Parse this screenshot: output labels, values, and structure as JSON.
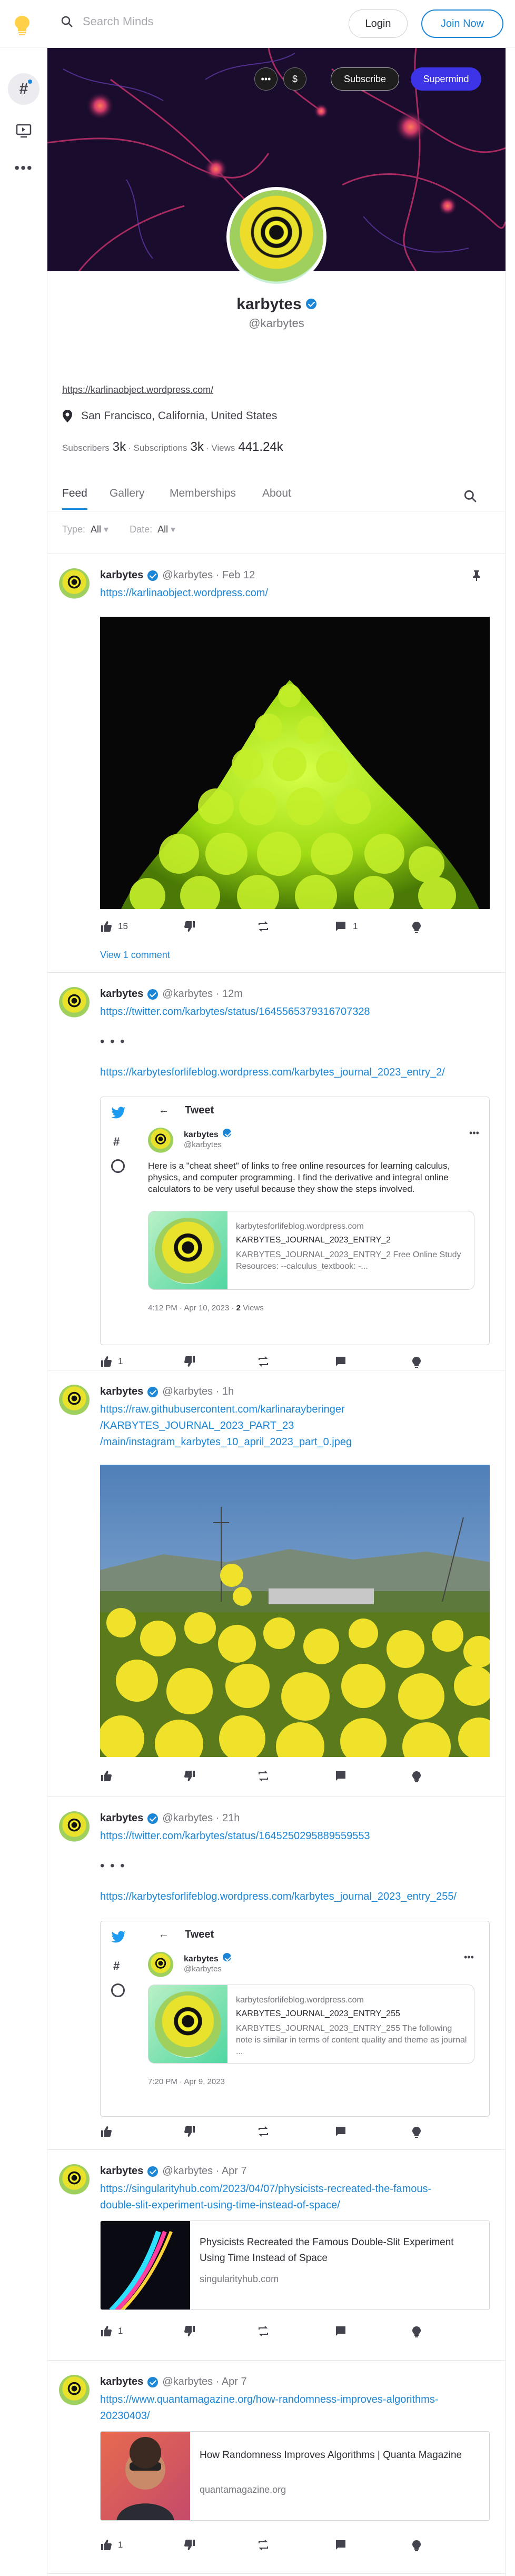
{
  "topbar": {
    "search_placeholder": "Search Minds",
    "login_label": "Login",
    "join_label": "Join Now"
  },
  "banner": {
    "subscribe_label": "Subscribe",
    "supermind_label": "Supermind"
  },
  "profile": {
    "name": "karbytes",
    "handle": "@karbytes",
    "link": "https://karlinaobject.wordpress.com/",
    "location": "San Francisco, California, United States",
    "subscribers_label": "Subscribers",
    "subscribers": "3k",
    "subscriptions_label": "· Subscriptions",
    "subscriptions": "3k",
    "views_label": "· Views",
    "views": "441.24k"
  },
  "tabs": [
    "Feed",
    "Gallery",
    "Memberships",
    "About"
  ],
  "filters": {
    "type_label": "Type:",
    "type_value": "All",
    "date_label": "Date:",
    "date_value": "All"
  },
  "posts": [
    {
      "name": "karbytes",
      "handle": "@karbytes · Feb 12",
      "link": "https://karlinaobject.wordpress.com/",
      "likes": "15",
      "comments": "1",
      "view_comments": "View 1 comment"
    },
    {
      "name": "karbytes",
      "handle": "@karbytes · 12m",
      "link1": "https://twitter.com/karbytes/status/1645565379316707328",
      "dots": "• • •",
      "link2": "https://karbytesforlifeblog.wordpress.com/karbytes_journal_2023_entry_2/",
      "tweet": {
        "header": "Tweet",
        "name": "karbytes",
        "handle": "@karbytes",
        "text": "Here is a \"cheat sheet\" of links to free online resources for learning calculus, physics, and computer programming. I find the derivative and integral online calculators to be very useful because they show the steps involved.",
        "card_domain": "karbytesforlifeblog.wordpress.com",
        "card_title": "KARBYTES_JOURNAL_2023_ENTRY_2",
        "card_desc": "KARBYTES_JOURNAL_2023_ENTRY_2 Free Online Study Resources: --calculus_textbook: -...",
        "time": "4:12 PM · Apr 10, 2023 ·",
        "views_n": "2",
        "views": "Views"
      },
      "likes": "1"
    },
    {
      "name": "karbytes",
      "handle": "@karbytes · 1h",
      "link_lines": [
        "https://raw.githubusercontent.com/karlinarayberinger",
        "/KARBYTES_JOURNAL_2023_PART_23",
        "/main/instagram_karbytes_10_april_2023_part_0.jpeg"
      ]
    },
    {
      "name": "karbytes",
      "handle": "@karbytes · 21h",
      "link1": "https://twitter.com/karbytes/status/1645250295889559553",
      "dots": "• • •",
      "link2": "https://karbytesforlifeblog.wordpress.com/karbytes_journal_2023_entry_255/",
      "tweet": {
        "header": "Tweet",
        "name": "karbytes",
        "handle": "@karbytes",
        "card_domain": "karbytesforlifeblog.wordpress.com",
        "card_title": "KARBYTES_JOURNAL_2023_ENTRY_255",
        "card_desc": "KARBYTES_JOURNAL_2023_ENTRY_255 The following note is similar in terms of content quality and theme as journal ...",
        "time": "7:20 PM · Apr 9, 2023"
      }
    },
    {
      "name": "karbytes",
      "handle": "@karbytes · Apr 7",
      "link_lines": [
        "https://singularityhub.com/2023/04/07/physicists-recreated-the-famous-",
        "double-slit-experiment-using-time-instead-of-space/"
      ],
      "card_title": "Physicists Recreated the Famous Double-Slit Experiment Using Time Instead of Space",
      "card_src": "singularityhub.com",
      "likes": "1"
    },
    {
      "name": "karbytes",
      "handle": "@karbytes · Apr 7",
      "link_lines": [
        "https://www.quantamagazine.org/how-randomness-improves-algorithms-",
        "20230403/"
      ],
      "card_title": "How Randomness Improves Algorithms | Quanta Magazine",
      "card_src": "quantamagazine.org",
      "likes": "1"
    }
  ]
}
